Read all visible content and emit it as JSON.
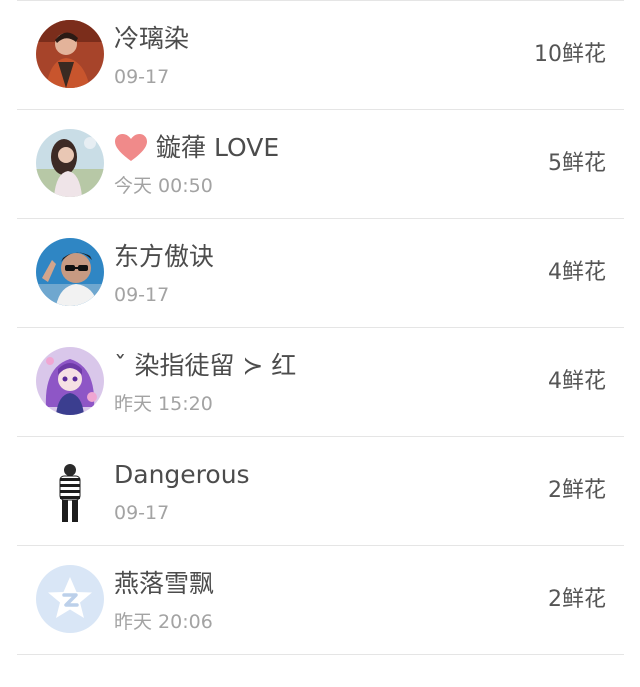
{
  "ranking": {
    "rows": [
      {
        "name": "冷璃染",
        "time": "09-17",
        "flowers": "10鲜花",
        "avatar_icon": "portrait-photo"
      },
      {
        "name": "鏇葎 LOVE",
        "time": "今天 00:50",
        "flowers": "5鲜花",
        "avatar_icon": "girl-photo",
        "name_prefix_icon": "heart-emoji"
      },
      {
        "name": "东方傲诀",
        "time": "09-17",
        "flowers": "4鲜花",
        "avatar_icon": "sunglasses-photo"
      },
      {
        "name": "ˇ 染指徒留 ≻ 红",
        "time": "昨天 15:20",
        "flowers": "4鲜花",
        "avatar_icon": "anime-girl-photo"
      },
      {
        "name": "Dangerous",
        "time": "09-17",
        "flowers": "2鲜花",
        "avatar_icon": "striped-figure-photo"
      },
      {
        "name": "燕落雪飘",
        "time": "昨天 20:06",
        "flowers": "2鲜花",
        "avatar_icon": "qq-default-avatar"
      }
    ]
  },
  "colors": {
    "name_text": "#4c4c4c",
    "time_text": "#a3a3a3",
    "flowers_text": "#555555",
    "divider": "#e5e5e5",
    "heart": "#f08a8a"
  }
}
